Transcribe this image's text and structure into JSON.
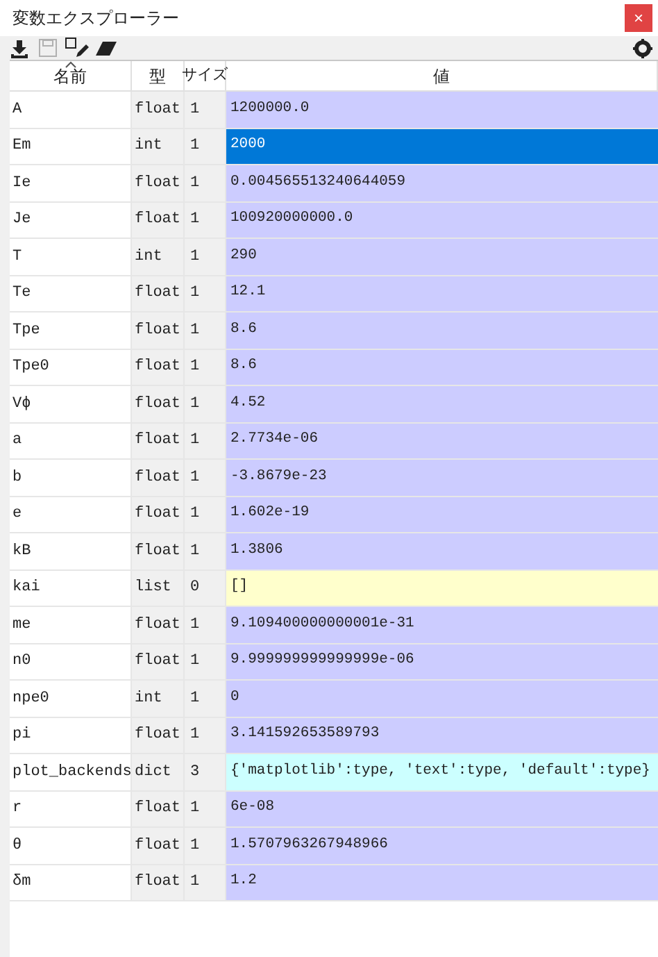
{
  "window": {
    "title": "変数エクスプローラー",
    "close_label": "×"
  },
  "toolbar": {
    "buttons": [
      {
        "kind": "import",
        "disabled": false
      },
      {
        "kind": "save",
        "disabled": true
      },
      {
        "kind": "save_as",
        "disabled": false
      },
      {
        "kind": "erase",
        "disabled": false
      }
    ]
  },
  "table": {
    "columns": [
      {
        "label": "名前",
        "sorted": true
      },
      {
        "label": "型",
        "sorted": false
      },
      {
        "label": "サイズ",
        "sorted": false
      },
      {
        "label": "値",
        "sorted": false
      }
    ],
    "rows": [
      {
        "name": "A",
        "type": "float",
        "size": "1",
        "value": "1200000.0",
        "color": "#ccccff",
        "selected": false
      },
      {
        "name": "Em",
        "type": "int",
        "size": "1",
        "value": "2000",
        "selected": true
      },
      {
        "name": "Ie",
        "type": "float",
        "size": "1",
        "value": "0.004565513240644059",
        "color": "#ccccff",
        "selected": false
      },
      {
        "name": "Je",
        "type": "float",
        "size": "1",
        "value": "100920000000.0",
        "color": "#ccccff",
        "selected": false
      },
      {
        "name": "T",
        "type": "int",
        "size": "1",
        "value": "290",
        "color": "#ccccff",
        "selected": false
      },
      {
        "name": "Te",
        "type": "float",
        "size": "1",
        "value": "12.1",
        "color": "#ccccff",
        "selected": false
      },
      {
        "name": "Tpe",
        "type": "float",
        "size": "1",
        "value": "8.6",
        "color": "#ccccff",
        "selected": false
      },
      {
        "name": "Tpe0",
        "type": "float",
        "size": "1",
        "value": "8.6",
        "color": "#ccccff",
        "selected": false
      },
      {
        "name": "Vϕ",
        "type": "float",
        "size": "1",
        "value": "4.52",
        "color": "#ccccff",
        "selected": false
      },
      {
        "name": "a",
        "type": "float",
        "size": "1",
        "value": "2.7734e-06",
        "color": "#ccccff",
        "selected": false
      },
      {
        "name": "b",
        "type": "float",
        "size": "1",
        "value": "-3.8679e-23",
        "color": "#ccccff",
        "selected": false
      },
      {
        "name": "e",
        "type": "float",
        "size": "1",
        "value": "1.602e-19",
        "color": "#ccccff",
        "selected": false
      },
      {
        "name": "kB",
        "type": "float",
        "size": "1",
        "value": "1.3806",
        "color": "#ccccff",
        "selected": false
      },
      {
        "name": "kai",
        "type": "list",
        "size": "0",
        "value": "[]",
        "color": "#ffffcc",
        "selected": false
      },
      {
        "name": "me",
        "type": "float",
        "size": "1",
        "value": "9.109400000000001e-31",
        "color": "#ccccff",
        "selected": false
      },
      {
        "name": "n0",
        "type": "float",
        "size": "1",
        "value": "9.999999999999999e-06",
        "color": "#ccccff",
        "selected": false
      },
      {
        "name": "npe0",
        "type": "int",
        "size": "1",
        "value": "0",
        "color": "#ccccff",
        "selected": false
      },
      {
        "name": "pi",
        "type": "float",
        "size": "1",
        "value": "3.141592653589793",
        "color": "#ccccff",
        "selected": false
      },
      {
        "name": "plot_backends",
        "type": "dict",
        "size": "3",
        "value": "{'matplotlib':type, 'text':type, 'default':type}",
        "color": "#ccffff",
        "selected": false
      },
      {
        "name": "r",
        "type": "float",
        "size": "1",
        "value": "6e-08",
        "color": "#ccccff",
        "selected": false
      },
      {
        "name": "θ",
        "type": "float",
        "size": "1",
        "value": "1.5707963267948966",
        "color": "#ccccff",
        "selected": false
      },
      {
        "name": "δm",
        "type": "float",
        "size": "1",
        "value": "1.2",
        "color": "#ccccff",
        "selected": false
      }
    ]
  }
}
